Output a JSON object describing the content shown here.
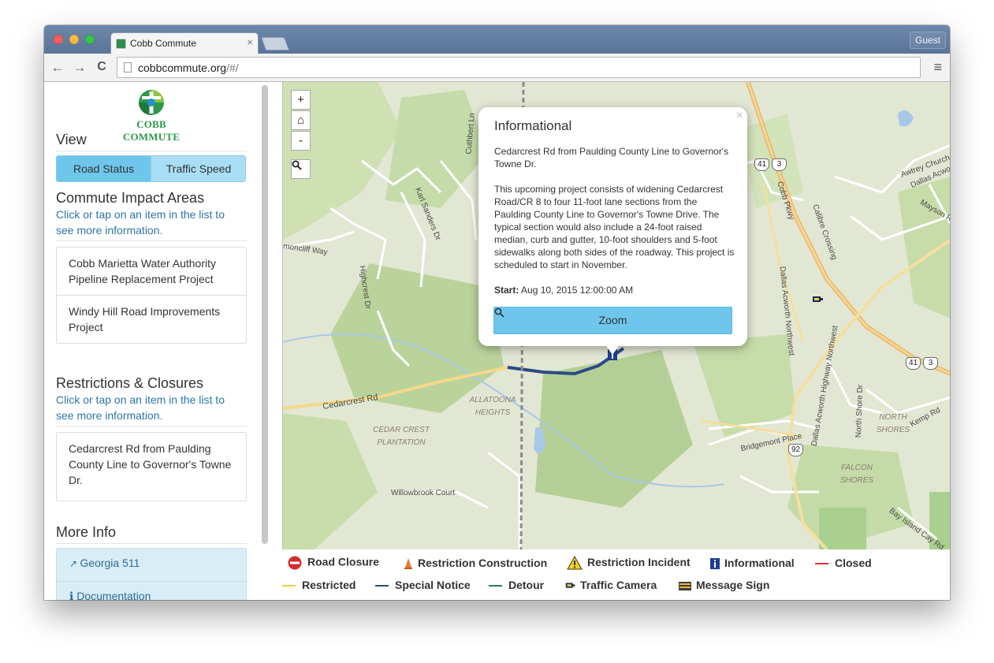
{
  "browser": {
    "tab_title": "Cobb Commute",
    "tab_close": "×",
    "guest_label": "Guest",
    "url_host": "cobbcommute.org",
    "url_path": "/#/",
    "back": "←",
    "forward": "→",
    "reload": "C",
    "menu": "≡"
  },
  "sidebar": {
    "logo_text": "COBB COMMUTE",
    "view_heading": "View",
    "view_toggle": {
      "road_status": "Road Status",
      "traffic_speed": "Traffic Speed",
      "selected": "Road Status"
    },
    "impact_heading": "Commute Impact Areas",
    "impact_help": "Click or tap on an item in the list to see more information.",
    "impact_items": [
      "Cobb Marietta Water Authority Pipeline Replacement Project",
      "Windy Hill Road Improvements Project"
    ],
    "restrictions_heading": "Restrictions & Closures",
    "restrictions_help": "Click or tap on an item in the list to see more information.",
    "restriction_items": [
      "Cedarcrest Rd from Paulding County Line to Governor's Towne Dr."
    ],
    "more_info_heading": "More Info",
    "more_info_items": [
      "Georgia 511",
      "Documentation"
    ]
  },
  "map": {
    "controls": {
      "zoom_in": "+",
      "home": "⌂",
      "zoom_out": "-",
      "search": "search"
    },
    "labels": {
      "cuthbert_ln": "Cuthbert Ln",
      "karl_sanders_dr": "Karl Sanders Dr",
      "highcrest_dr": "Highcrest Dr",
      "cedarcrest_rd": "Cedarcrest Rd",
      "willowbrook_court": "Willowbrook Court",
      "cobb_pkwy": "Cobb Pkwy",
      "dallas_acworth_nw": "Dallas Acworth Northwest",
      "dallas_acworth_hwy_nw": "Dallas Acworth Highway Northwest",
      "north_shore_dr": "North Shore Dr",
      "bridgemont_place": "Bridgemont Place",
      "kemp_rd": "Kemp Rd",
      "bay_island_cay_rd": "Bay Island Cay Rd",
      "calibre_crossing": "Calibre Crossing",
      "awtrey_church": "Awtrey Church R",
      "dallas_acworth_tr": "Dallas Acworth",
      "mayson": "Mayson R",
      "moncliff_way": "moncliff Way",
      "allatoona_heights": "ALLATOONA HEIGHTS",
      "cedar_crest_plantation": "CEDAR CREST PLANTATION",
      "north_shores": "NORTH SHORES",
      "falcon_shores": "FALCON SHORES"
    },
    "shields": [
      "41",
      "3",
      "41",
      "3",
      "92"
    ],
    "popup": {
      "title": "Informational",
      "close": "×",
      "location": "Cedarcrest Rd from Paulding County Line to Governor's Towne Dr.",
      "description": "This upcoming project consists of widening Cedarcrest Road/CR 8 to four 11-foot lane sections from the Paulding County Line to Governor's Towne Drive. The typical section would also include a 24-foot raised median, curb and gutter, 10-foot shoulders and 5-foot sidewalks along both sides of the roadway. This project is scheduled to start in November.",
      "start_label": "Start:",
      "start_value": "Aug 10, 2015 12:00:00 AM",
      "zoom_label": "Zoom"
    }
  },
  "legend": {
    "road_closure": "Road Closure",
    "restriction_construction": "Restriction Construction",
    "restriction_incident": "Restriction Incident",
    "informational": "Informational",
    "closed": "Closed",
    "restricted": "Restricted",
    "special_notice": "Special Notice",
    "detour": "Detour",
    "traffic_camera": "Traffic Camera",
    "message_sign": "Message Sign",
    "colors": {
      "closed": "#e03030",
      "restricted": "#f2c94c",
      "special_notice": "#2c4a86",
      "detour": "#2e7d4f"
    }
  }
}
